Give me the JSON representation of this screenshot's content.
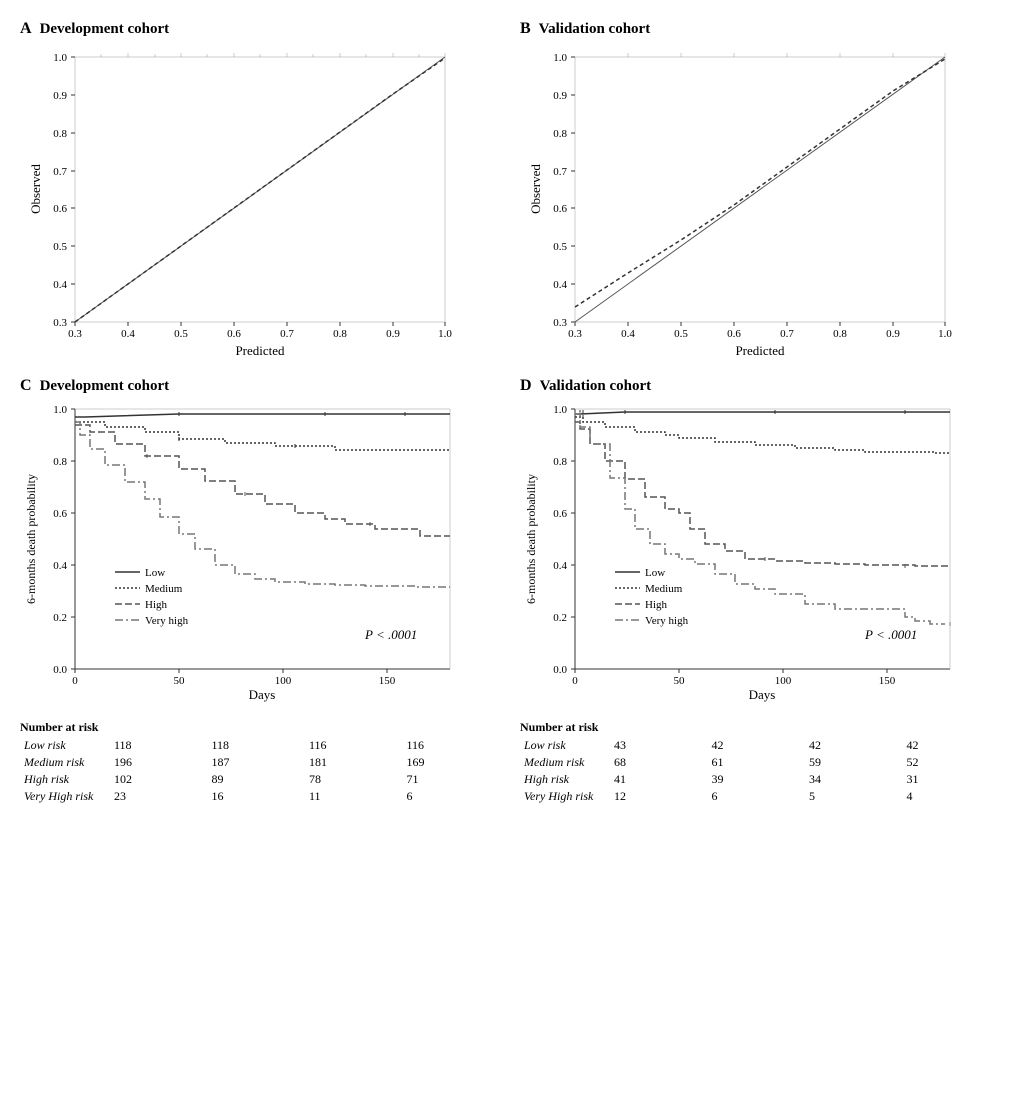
{
  "panels": {
    "A": {
      "label": "A",
      "title": "Development cohort",
      "x_label": "Predicted",
      "y_label": "Observed",
      "x_range": [
        0.3,
        1.0
      ],
      "y_range": [
        0.3,
        1.0
      ],
      "x_ticks": [
        0.3,
        0.4,
        0.5,
        0.6,
        0.7,
        0.8,
        0.9,
        1.0
      ],
      "y_ticks": [
        0.3,
        0.4,
        0.5,
        0.6,
        0.7,
        0.8,
        0.9,
        1.0
      ]
    },
    "B": {
      "label": "B",
      "title": "Validation cohort",
      "x_label": "Predicted",
      "y_label": "Observed",
      "x_range": [
        0.3,
        1.0
      ],
      "y_range": [
        0.3,
        1.0
      ],
      "x_ticks": [
        0.3,
        0.4,
        0.5,
        0.6,
        0.7,
        0.8,
        0.9,
        1.0
      ],
      "y_ticks": [
        0.3,
        0.4,
        0.5,
        0.6,
        0.7,
        0.8,
        0.9,
        1.0
      ]
    },
    "C": {
      "label": "C",
      "title": "Development cohort",
      "x_label": "Days",
      "y_label": "6-months death probability",
      "p_value": "P < .0001",
      "legend": [
        "Low",
        "Medium",
        "High",
        "Very high"
      ],
      "risk_table_title": "Number at risk",
      "risk_rows": [
        {
          "label": "Low risk",
          "values": [
            "118",
            "118",
            "116",
            "116"
          ]
        },
        {
          "label": "Medium risk",
          "values": [
            "196",
            "187",
            "181",
            "169"
          ]
        },
        {
          "label": "High risk",
          "values": [
            "102",
            "89",
            "78",
            "71"
          ]
        },
        {
          "label": "Very High risk",
          "values": [
            "23",
            "16",
            "11",
            "6"
          ]
        }
      ]
    },
    "D": {
      "label": "D",
      "title": "Validation cohort",
      "x_label": "Days",
      "y_label": "6-months death probability",
      "p_value": "P < .0001",
      "legend": [
        "Low",
        "Medium",
        "High",
        "Very high"
      ],
      "risk_table_title": "Number at risk",
      "risk_rows": [
        {
          "label": "Low risk",
          "values": [
            "43",
            "42",
            "42",
            "42"
          ]
        },
        {
          "label": "Medium risk",
          "values": [
            "68",
            "61",
            "59",
            "52"
          ]
        },
        {
          "label": "High risk",
          "values": [
            "41",
            "39",
            "34",
            "31"
          ]
        },
        {
          "label": "Very High risk",
          "values": [
            "12",
            "6",
            "5",
            "4"
          ]
        }
      ]
    }
  }
}
